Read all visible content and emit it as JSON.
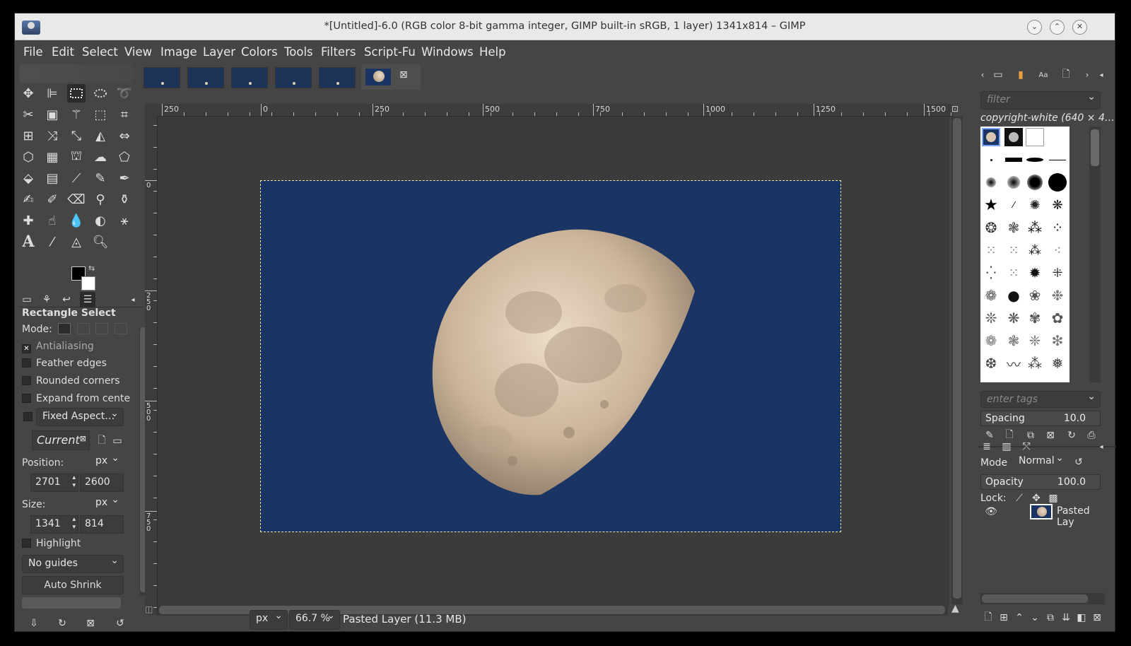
{
  "window": {
    "title": "*[Untitled]-6.0 (RGB color 8-bit gamma integer, GIMP built-in sRGB, 1 layer) 1341x814 – GIMP",
    "minimize_icon": "chevron-down-icon",
    "maximize_icon": "chevron-up-icon",
    "close_icon": "close-icon"
  },
  "menu": [
    "File",
    "Edit",
    "Select",
    "View",
    "Image",
    "Layer",
    "Colors",
    "Tools",
    "Filters",
    "Script-Fu",
    "Windows",
    "Help"
  ],
  "tool_options": {
    "title": "Rectangle Select",
    "mode_label": "Mode:",
    "antialiasing": "Antialiasing",
    "feather_edges": "Feather edges",
    "rounded_corners": "Rounded corners",
    "expand_from_center": "Expand from cente",
    "fixed_aspect": "Fixed Aspect…",
    "current": "Current",
    "position_label": "Position:",
    "position_unit": "px",
    "position_x": "2701",
    "position_y": "2600",
    "size_label": "Size:",
    "size_unit": "px",
    "size_w": "1341",
    "size_h": "814",
    "highlight": "Highlight",
    "guides": "No guides",
    "auto_shrink": "Auto Shrink"
  },
  "rulers": {
    "h_labels": [
      "250",
      "0",
      "250",
      "500",
      "750",
      "1000",
      "1250",
      "1500"
    ],
    "v_labels": [
      "0",
      "250",
      "500",
      "750"
    ]
  },
  "statusbar": {
    "unit": "px",
    "zoom": "66.7 %",
    "message": "Pasted Layer (11.3 MB)"
  },
  "brushes": {
    "filter_placeholder": "filter",
    "selected_brush": "copyright-white (640 × 4…",
    "tags_placeholder": "enter tags",
    "spacing_label": "Spacing",
    "spacing_value": "10.0"
  },
  "layers": {
    "mode_label": "Mode",
    "mode_value": "Normal",
    "opacity_label": "Opacity",
    "opacity_value": "100.0",
    "lock_label": "Lock:",
    "layer_name": "Pasted Lay"
  },
  "colors": {
    "fg": "#000000",
    "bg": "#ffffff",
    "image_bg": "#1a3563"
  }
}
